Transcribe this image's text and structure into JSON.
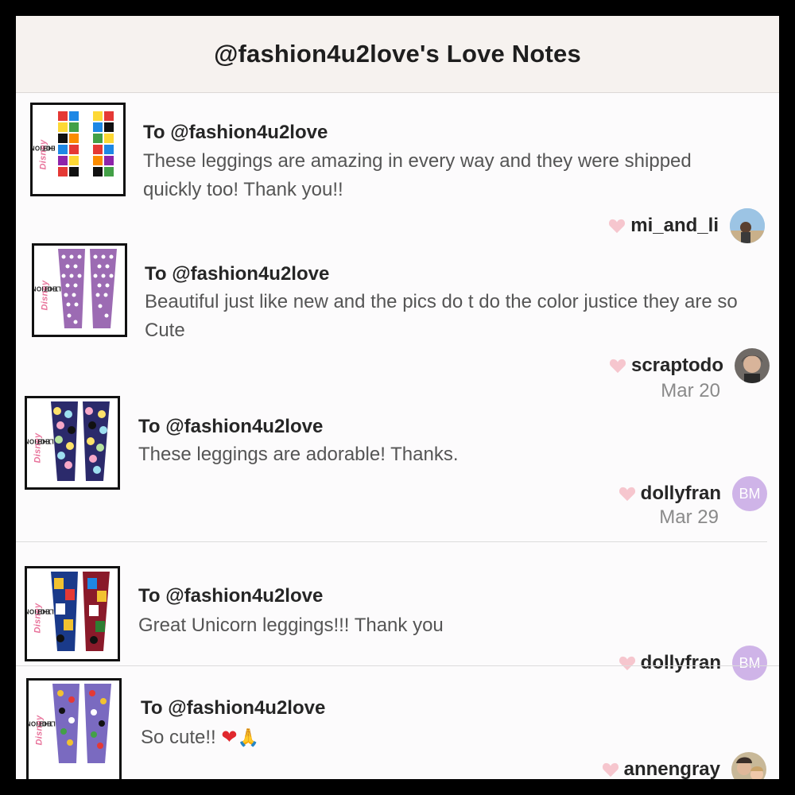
{
  "header": {
    "title": "@fashion4u2love's Love Notes"
  },
  "brand": {
    "the": "THE",
    "name": "Disney",
    "collection": "COLLECTION"
  },
  "notes": [
    {
      "to": "To @fashion4u2love",
      "message": "These leggings are amazing in every way and they were shipped quickly too! Thank you!!",
      "author": "mi_and_li",
      "date": "",
      "avatar_initials": "",
      "thumbnail_pattern": "multicolor-mickey-blocks"
    },
    {
      "to": "To @fashion4u2love",
      "message": "Beautiful just like new and the pics do t do the color justice they are so Cute",
      "author": "scraptodo",
      "date": "Mar 20",
      "avatar_initials": "",
      "thumbnail_pattern": "purple-polka-dots"
    },
    {
      "to": "To @fashion4u2love",
      "message": "These leggings are adorable! Thanks.",
      "author": "dollyfran",
      "date": "Mar 29",
      "avatar_initials": "BM",
      "thumbnail_pattern": "pastel-mickey-heads"
    },
    {
      "to": "To @fashion4u2love",
      "message": "Great Unicorn leggings!!! Thank you",
      "author": "dollyfran",
      "date": "",
      "avatar_initials": "BM",
      "thumbnail_pattern": "mickey-comic-panels"
    },
    {
      "to": "To @fashion4u2love",
      "message": "So cute!!",
      "message_emoji": [
        "red-heart",
        "folded-hands"
      ],
      "author": "annengray",
      "date": "",
      "avatar_initials": "",
      "thumbnail_pattern": "purple-character-print"
    }
  ],
  "colors": {
    "header_bg": "#f6f2ef",
    "heart": "#f6c6ce",
    "avatar_initials_bg": "#cfb4e8",
    "date_text": "#8a8a8a"
  },
  "icons": [
    "heart-icon",
    "avatar-photo",
    "avatar-initials"
  ]
}
